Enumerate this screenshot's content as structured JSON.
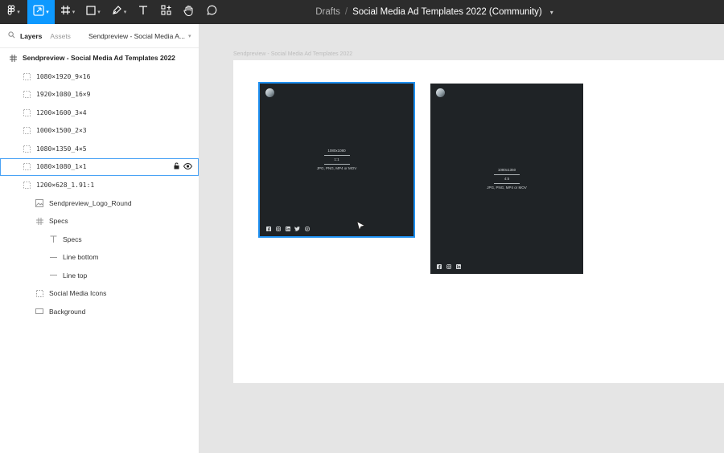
{
  "toolbar": {
    "title": {
      "drafts": "Drafts",
      "separator": "/",
      "file_name": "Social Media Ad Templates 2022 (Community)"
    }
  },
  "sidebar": {
    "tabs": {
      "layers": "Layers",
      "assets": "Assets"
    },
    "page_select": "Sendpreview - Social Media A..."
  },
  "layers": {
    "top": "Sendpreview - Social Media Ad Templates 2022",
    "frames": [
      "1080×1920_9×16",
      "1920×1080_16×9",
      "1200×1600_3×4",
      "1000×1500_2×3",
      "1080×1350_4×5",
      "1080×1080_1×1",
      "1200×628_1.91:1"
    ],
    "children": {
      "logo": "Sendpreview_Logo_Round",
      "specs_group": "Specs",
      "specs_text": "Specs",
      "line_bottom": "Line bottom",
      "line_top": "Line top",
      "social_icons": "Social Media Icons",
      "background": "Background"
    }
  },
  "canvas": {
    "frame_label": "Sendpreview - Social Media Ad Templates 2022",
    "artboard_square": {
      "size": "1080x1080",
      "ratio": "1:1",
      "formats": "JPG, PNG, MP4 or MOV",
      "socials": [
        "facebook",
        "instagram",
        "linkedin",
        "twitter",
        "pinterest"
      ]
    },
    "artboard_portrait": {
      "size": "1080x1350",
      "ratio": "4:5",
      "formats": "JPG, PNG, MP4 or MOV",
      "socials": [
        "facebook",
        "instagram",
        "linkedin"
      ]
    }
  },
  "colors": {
    "toolbar_bg": "#2c2c2c",
    "accent": "#0d99ff",
    "artboard_bg": "#1f2326",
    "selection": "#1e8ff0"
  }
}
